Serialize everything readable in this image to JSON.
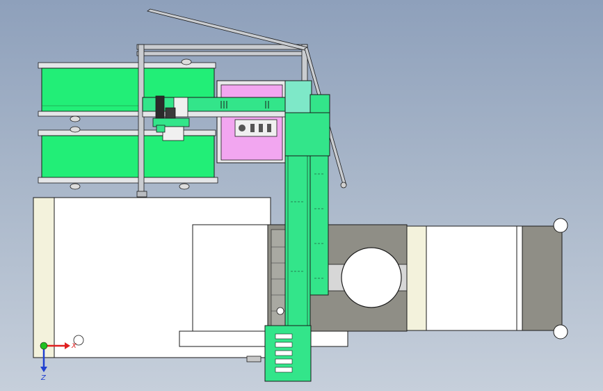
{
  "axes": {
    "x_label": "X",
    "z_label": "Z",
    "x_color": "#e02020",
    "z_color": "#2040d0",
    "origin_color": "#20c020"
  },
  "palette": {
    "background_top": "#8ea0bb",
    "background_bottom": "#c6cfdb",
    "conveyor_green": "#22ee77",
    "gantry_green": "#33e58a",
    "pink_plate": "#f2a6f0",
    "base_white": "#ffffff",
    "cream_band": "#f3f2dc",
    "machine_gray": "#8f8e86",
    "dark_gray": "#6f6f6a",
    "frame_gray": "#9aa0a6",
    "outline": "#1a1a1a"
  },
  "components": [
    {
      "name": "conveyor-upper",
      "label": "conveyor"
    },
    {
      "name": "conveyor-lower",
      "label": "conveyor"
    },
    {
      "name": "gantry-frame",
      "label": "frame"
    },
    {
      "name": "pink-plate",
      "label": "plate"
    },
    {
      "name": "vertical-gantry-arm",
      "label": "arm"
    },
    {
      "name": "machine-base",
      "label": "base"
    },
    {
      "name": "control-box",
      "label": "control"
    }
  ],
  "control_switches": 5
}
